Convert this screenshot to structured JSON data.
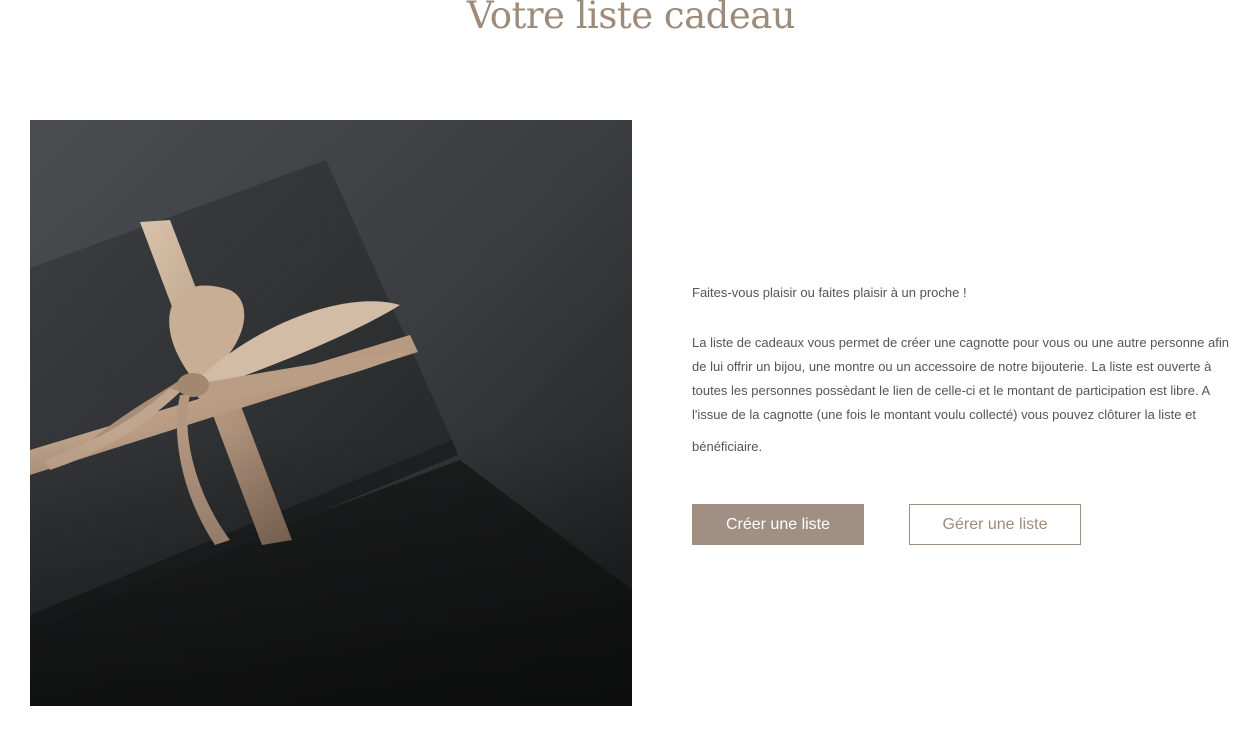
{
  "header": {
    "title": "Votre liste cadeau"
  },
  "hero": {
    "image_alt": "Coffret cadeau noir avec ruban satiné",
    "image_icon": "gift-box-photo"
  },
  "content": {
    "intro": "Faites-vous plaisir ou faites plaisir à un proche !",
    "description": "La liste de cadeaux vous permet de créer une cagnotte pour vous ou une autre personne afin de lui offrir un bijou, une montre ou un accessoire de notre bijouterie. La liste est ouverte à toutes les personnes possèdant le lien de celle-ci et le montant de participation est libre. A l'issue de la cagnotte (une fois le montant voulu collecté) vous pouvez clôturer la liste et",
    "description_end": "bénéficiaire."
  },
  "actions": {
    "create_label": "Créer une liste",
    "manage_label": "Gérer une liste"
  },
  "colors": {
    "accent": "#a08f82",
    "title": "#9d8b7c",
    "text": "#555555"
  }
}
